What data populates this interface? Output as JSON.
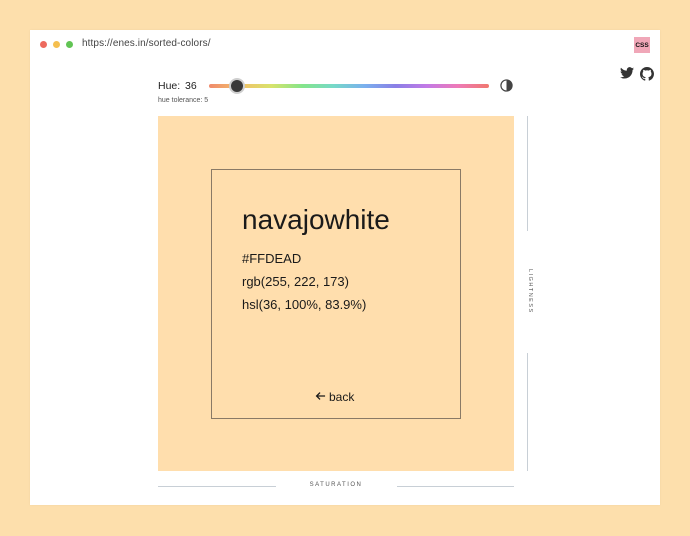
{
  "browser": {
    "url": "https://enes.in/sorted-colors/",
    "badge": "CSS"
  },
  "controls": {
    "hue_label": "Hue:",
    "hue_value": "36",
    "hue_fraction": 0.1,
    "tolerance_text": "hue tolerance: 5"
  },
  "color": {
    "name": "navajowhite",
    "hex": "#FFDEAD",
    "rgb": "rgb(255, 222, 173)",
    "hsl": "hsl(36, 100%, 83.9%)",
    "swatch_hex": "#ffdead"
  },
  "card": {
    "back_label": "back"
  },
  "axes": {
    "lightness": "LIGHTNESS",
    "saturation": "SATURATION"
  },
  "icons": {
    "social": [
      "twitter-icon",
      "github-icon"
    ],
    "contrast": "contrast-icon",
    "back": "arrow-left-icon"
  },
  "colors": {
    "page_background": "#fddfac",
    "window": "#ffffff",
    "badge": "#f0a7b8",
    "dot_red": "#ed6a5e",
    "dot_yellow": "#f5bf4f",
    "dot_green": "#61c454"
  }
}
